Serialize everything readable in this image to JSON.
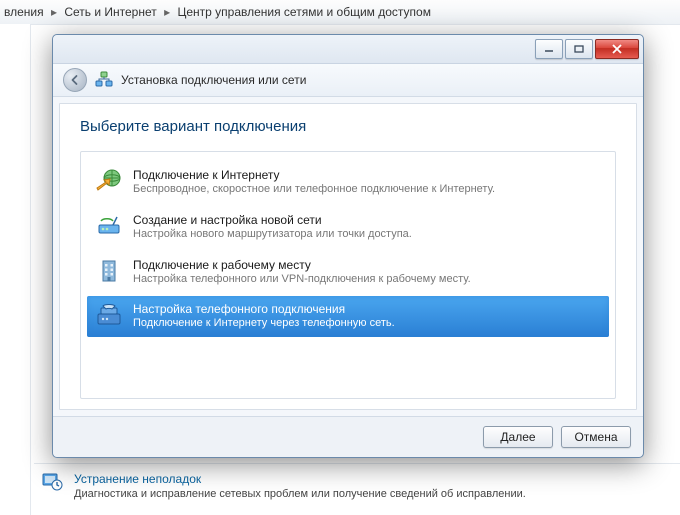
{
  "breadcrumb": {
    "items": [
      "вления",
      "Сеть и Интернет",
      "Центр управления сетями и общим доступом"
    ]
  },
  "subheader": {
    "title": "Установка подключения или сети"
  },
  "heading": "Выберите вариант подключения",
  "options": [
    {
      "title": "Подключение к Интернету",
      "desc": "Беспроводное, скоростное или телефонное подключение к Интернету.",
      "icon": "globe-arrow-icon"
    },
    {
      "title": "Создание и настройка новой сети",
      "desc": "Настройка нового маршрутизатора или точки доступа.",
      "icon": "router-icon"
    },
    {
      "title": "Подключение к рабочему месту",
      "desc": "Настройка телефонного или VPN-подключения к рабочему месту.",
      "icon": "building-icon"
    },
    {
      "title": "Настройка телефонного подключения",
      "desc": "Подключение к Интернету через телефонную сеть.",
      "icon": "phone-modem-icon"
    }
  ],
  "selected_index": 3,
  "footer": {
    "next": "Далее",
    "cancel": "Отмена"
  },
  "background_footer": {
    "link": "Устранение неполадок",
    "desc": "Диагностика и исправление сетевых проблем или получение сведений об исправлении."
  }
}
